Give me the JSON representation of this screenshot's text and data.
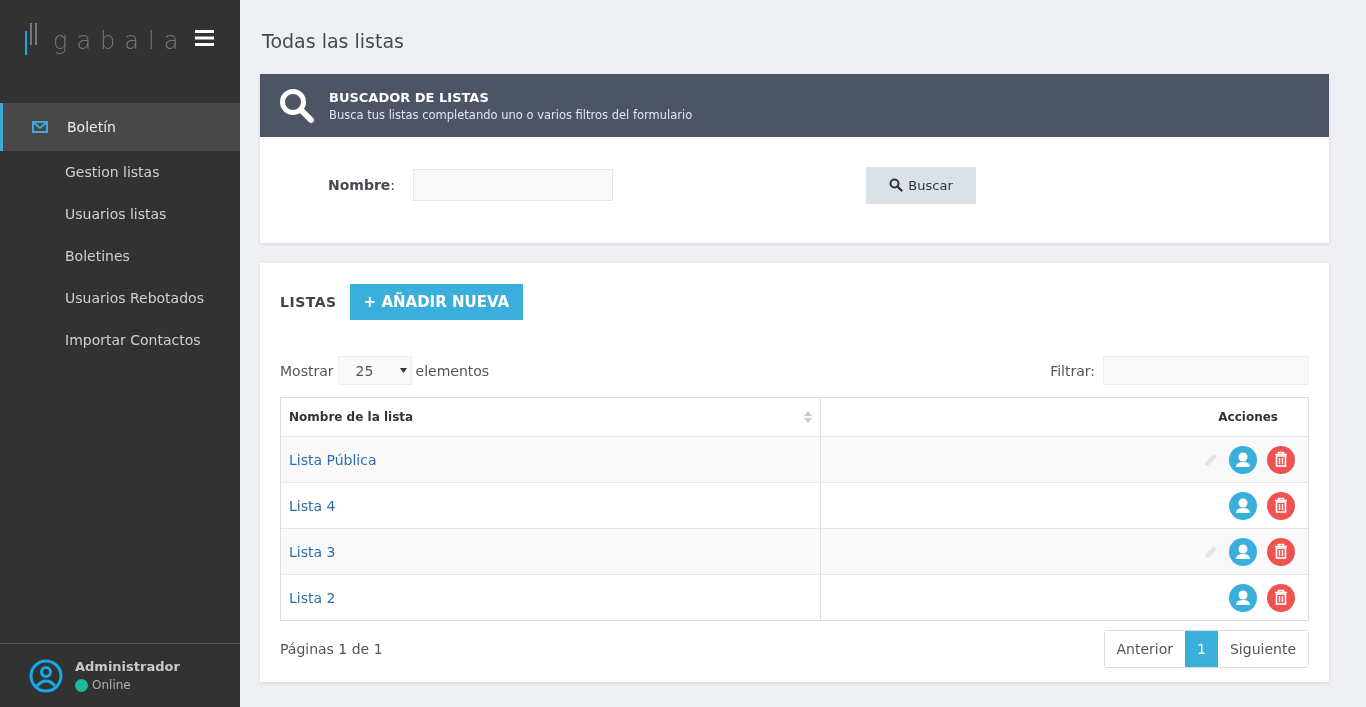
{
  "sidebar": {
    "logo": "gabala",
    "items": [
      {
        "label": "Boletín",
        "selected": true,
        "children": [
          {
            "label": "Gestion listas",
            "selected": false
          },
          {
            "label": "Usuarios listas",
            "selected": false
          },
          {
            "label": "Boletines",
            "selected": false
          },
          {
            "label": "Usuarios Rebotados",
            "selected": false
          },
          {
            "label": "Importar Contactos",
            "selected": false
          }
        ]
      }
    ],
    "user": {
      "name": "Administrador",
      "status": "Online",
      "color": "#1abc9c"
    }
  },
  "page_title": "Todas las listas",
  "search_panel": {
    "title": "BUSCADOR DE LISTAS",
    "subtitle": "Busca tus listas completando uno o varios filtros del formulario",
    "field_label": "Nombre",
    "field_suffix": ":",
    "button": "Buscar"
  },
  "lists_panel": {
    "title": "LISTAS",
    "add_button": "+ AÑADIR NUEVA",
    "show_label": "Mostrar",
    "page_size": "25",
    "show_suffix": "elementos",
    "filter_label": "Filtrar:",
    "columns": [
      "Nombre de la lista",
      "Acciones"
    ],
    "rows": [
      {
        "name": "Lista Pública",
        "edit_icon": true
      },
      {
        "name": "Lista 4",
        "edit_icon": false
      },
      {
        "name": "Lista 3",
        "edit_icon": true
      },
      {
        "name": "Lista 2",
        "edit_icon": false
      }
    ],
    "info": "Páginas 1 de 1",
    "pagination": [
      {
        "label": "Anterior",
        "selected": false
      },
      {
        "label": "1",
        "selected": true
      },
      {
        "label": "Siguiente",
        "selected": false
      }
    ]
  }
}
